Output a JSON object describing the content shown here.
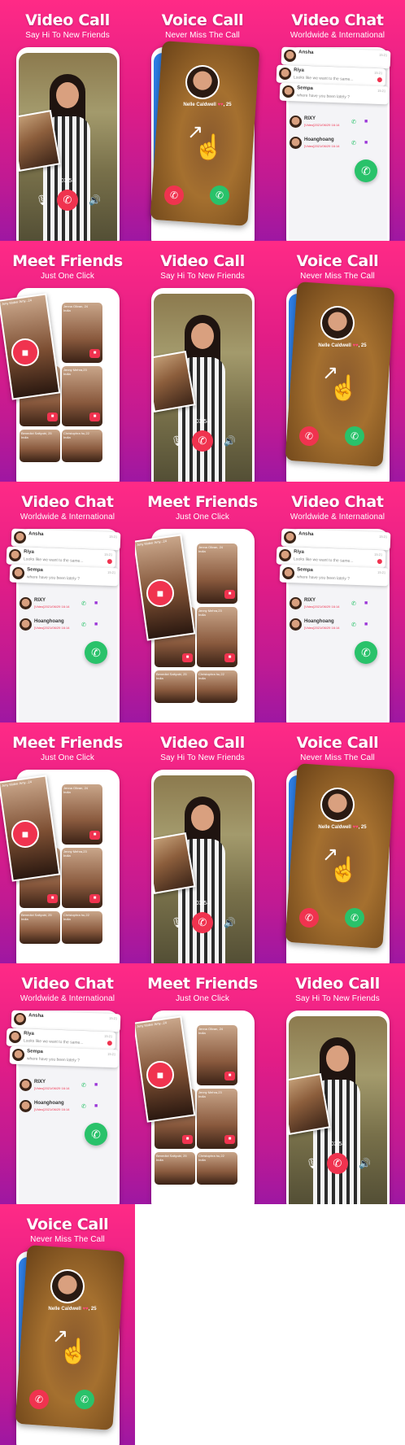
{
  "icons": {
    "mute": "mic-off-icon",
    "end_call": "phone-hangup-icon",
    "speaker": "speaker-icon",
    "accept": "phone-accept-icon",
    "swipe": "swipe-arrow-icon",
    "hand": "hand-pointer-icon",
    "video": "video-camera-icon",
    "call": "phone-icon"
  },
  "colors": {
    "gradient_top": "#ff2a86",
    "gradient_bottom": "#9e17a2",
    "end_call": "#f0334f",
    "accept": "#29c26a",
    "video": "#9b35d8"
  },
  "texts": {
    "video_call": {
      "title": "Video Call",
      "subtitle": "Say Hi To New Friends",
      "timer": "03:54"
    },
    "voice_call": {
      "title": "Voice Call",
      "subtitle": "Never Miss The Call",
      "caller": "Nelle Caldwell",
      "age": "25"
    },
    "video_chat": {
      "title": "Video Chat",
      "subtitle": "Worldwide & International",
      "cards": [
        {
          "name": "Ansha",
          "message": "",
          "time": "15:21"
        },
        {
          "name": "Riya",
          "message": "Looks like we want to the same...",
          "time": "15:21"
        },
        {
          "name": "Sempa",
          "message": "where have you been lately ?",
          "time": "15:21"
        }
      ],
      "list": [
        {
          "name": "RIXY",
          "message": "[Video]2021/06/29 16:14"
        },
        {
          "name": "Hoanghoang",
          "message": "[Video]2021/06/29 16:14"
        }
      ]
    },
    "meet_friends": {
      "title": "Meet Friends",
      "subtitle": "Just One Click",
      "profiles": [
        {
          "name": "Amy Mober Amy...24",
          "country": "India"
        },
        {
          "name": "Jenna Olivan, 24",
          "country": "India"
        },
        {
          "name": "Jenny Bolliyara, 25",
          "country": "India"
        },
        {
          "name": "Jenny Mehra,23",
          "country": "India"
        },
        {
          "name": "Benedict Saltyubi, 25",
          "country": "India"
        },
        {
          "name": "Christophra hu,22",
          "country": "India"
        }
      ]
    }
  },
  "tiles": [
    {
      "type": "video_call"
    },
    {
      "type": "voice_call"
    },
    {
      "type": "video_chat"
    },
    {
      "type": "meet_friends"
    },
    {
      "type": "video_call"
    },
    {
      "type": "voice_call"
    },
    {
      "type": "video_chat"
    },
    {
      "type": "meet_friends"
    },
    {
      "type": "video_chat"
    },
    {
      "type": "meet_friends"
    },
    {
      "type": "video_call"
    },
    {
      "type": "voice_call"
    },
    {
      "type": "video_chat"
    },
    {
      "type": "meet_friends"
    },
    {
      "type": "video_call"
    },
    {
      "type": "voice_call"
    }
  ]
}
